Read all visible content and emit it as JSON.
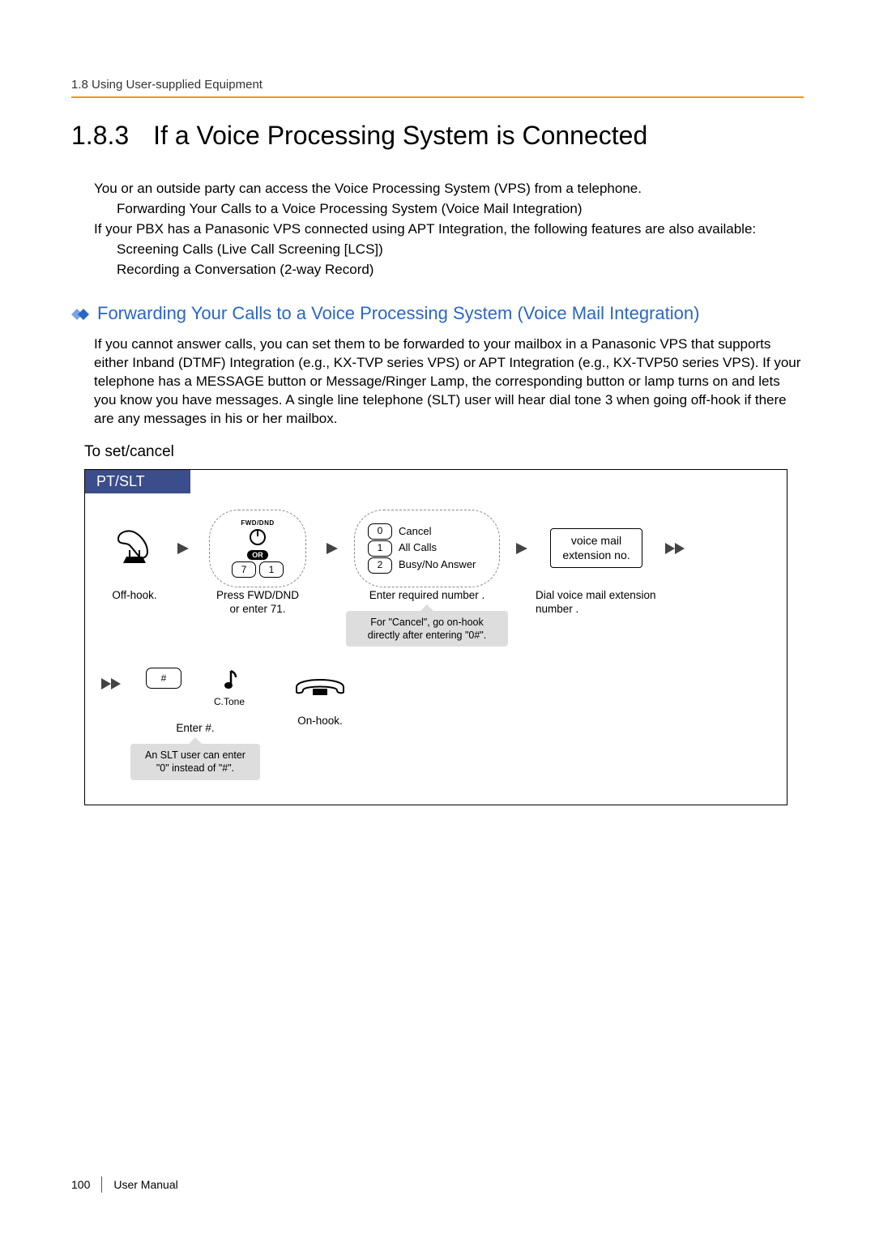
{
  "header": {
    "breadcrumb": "1.8 Using User-supplied Equipment"
  },
  "title": {
    "number": "1.8.3",
    "text": "If a Voice Processing System is Connected"
  },
  "intro": {
    "p1": "You or an outside party can access the Voice Processing System (VPS) from a telephone.",
    "b1": "Forwarding Your Calls to a Voice Processing System (Voice Mail Integration)",
    "p2": "If your PBX has a Panasonic VPS connected using APT Integration, the following features are also available:",
    "b2": "Screening Calls (Live Call Screening [LCS])",
    "b3": "Recording a Conversation (2-way Record)"
  },
  "section": {
    "heading": "Forwarding Your Calls to a Voice Processing System (Voice Mail Integration)",
    "para": "If you cannot answer calls, you can set them to be forwarded to your mailbox in a Panasonic VPS that supports either Inband (DTMF) Integration (e.g., KX-TVP series VPS) or APT Integration (e.g., KX-TVP50 series VPS). If your telephone has a MESSAGE button or Message/Ringer Lamp, the corresponding button or lamp turns on and lets you know you have messages. A single line telephone (SLT) user will hear dial tone 3 when going off-hook if there are any messages in his or her mailbox.",
    "subhead": "To set/cancel"
  },
  "diagram": {
    "titlebar": "PT/SLT",
    "step1": {
      "caption": "Off-hook."
    },
    "step2": {
      "btn_label": "FWD/DND",
      "or": "OR",
      "key7": "7",
      "key1": "1",
      "caption": "Press FWD/DND\nor enter 71."
    },
    "step3": {
      "opt0_key": "0",
      "opt0_label": "Cancel",
      "opt1_key": "1",
      "opt1_label": "All Calls",
      "opt2_key": "2",
      "opt2_label": "Busy/No Answer",
      "caption": "Enter required number .",
      "note": "For \"Cancel\", go on-hook directly after entering \"0#\"."
    },
    "step4": {
      "box_l1": "voice mail",
      "box_l2": "extension no.",
      "caption": "Dial voice mail extension number ."
    },
    "row2": {
      "hash_key": "#",
      "hash_caption": "Enter #.",
      "hash_note": "An SLT user can enter \"0\" instead of \"#\".",
      "tone_label": "C.Tone",
      "onhook_caption": "On-hook."
    }
  },
  "footer": {
    "page": "100",
    "label": "User Manual"
  }
}
